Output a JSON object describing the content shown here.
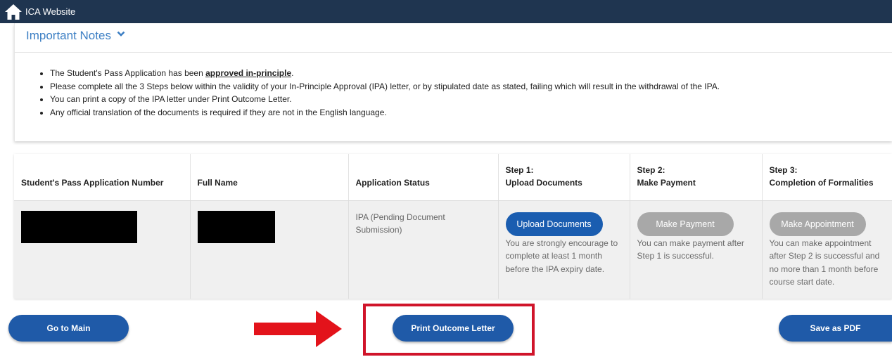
{
  "topbar": {
    "site_title": "ICA Website",
    "icon": "home-icon"
  },
  "notes": {
    "title": "Important Notes",
    "icon": "chevron-down-icon",
    "item1_prefix": "The Student's Pass Application has been ",
    "item1_bold": "approved in-principle",
    "item1_suffix": ".",
    "item2": "Please complete all the 3 Steps below within the validity of your In-Principle Approval (IPA) letter, or by stipulated date as stated, failing which will result in the withdrawal of the IPA.",
    "item3": "You can print a copy of the IPA letter under Print Outcome Letter.",
    "item4": "Any official translation of the documents is required if they are not in the English language."
  },
  "table": {
    "headers": {
      "app_number": "Student's Pass Application Number",
      "full_name": "Full Name",
      "status": "Application Status",
      "step1_title": "Step 1:",
      "step1_sub": "Upload Documents",
      "step2_title": "Step 2:",
      "step2_sub": "Make Payment",
      "step3_title": "Step 3:",
      "step3_sub": "Completion of Formalities"
    },
    "row": {
      "status": "IPA (Pending Document Submission)",
      "step1_button": "Upload Documents",
      "step1_hint": "You are strongly encourage to complete at least 1 month before the IPA expiry date.",
      "step2_button": "Make Payment",
      "step2_hint": "You can make payment after Step 1 is successful.",
      "step3_button": "Make Appointment",
      "step3_hint": "You can make appointment after Step 2 is successful and no more than 1 month before course start date."
    }
  },
  "actions": {
    "go_to_main": "Go to Main",
    "print_outcome": "Print Outcome Letter",
    "save_pdf": "Save as PDF"
  },
  "colors": {
    "topbar": "#1f3550",
    "primary_button": "#1f5aa8",
    "disabled_button": "#a8a8a8",
    "highlight": "#d0142a",
    "link_text": "#3d7fc4"
  }
}
